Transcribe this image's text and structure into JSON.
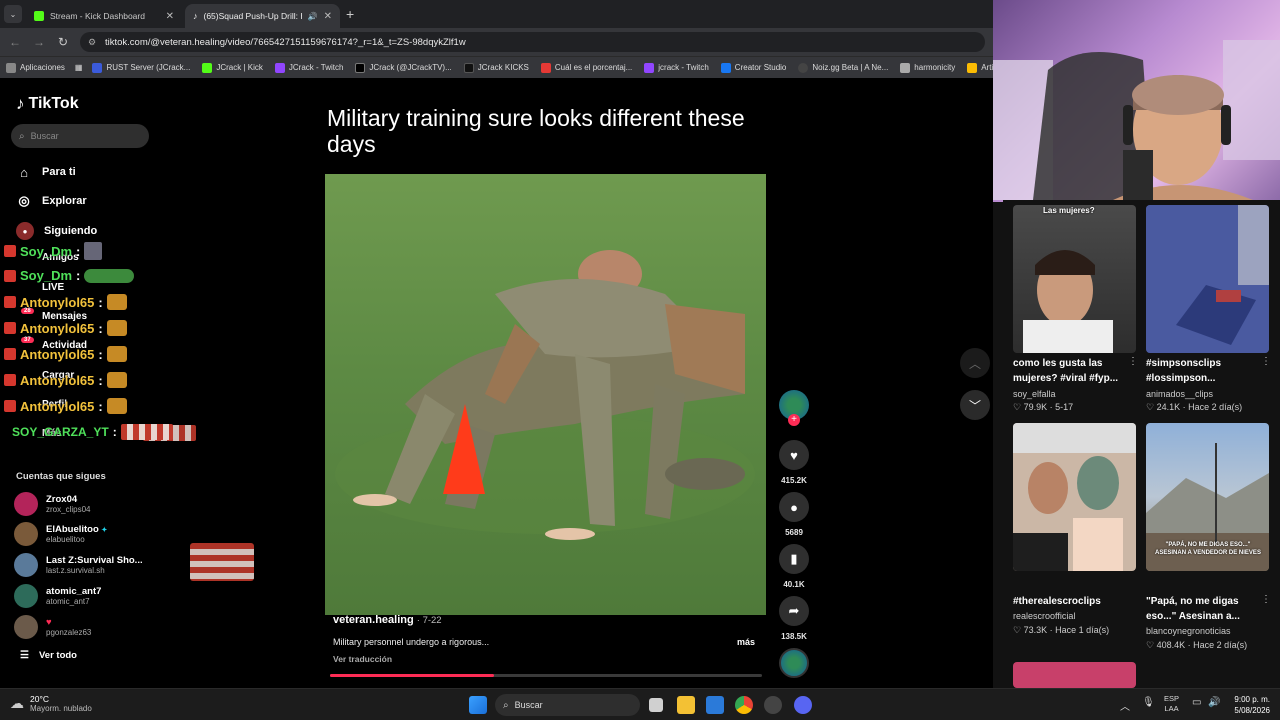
{
  "tabs": [
    {
      "label": "Stream - Kick Dashboard",
      "active": false
    },
    {
      "label": "(65)Squad Push-Up Drill: He",
      "active": true
    }
  ],
  "url": "tiktok.com/@veteran.healing/video/7665427151159676174?_r=1&_t=ZS-98dqykZlf1w",
  "bookmarks": [
    "Aplicaciones",
    "RUST Server (JCrack...",
    "JCrack | Kick",
    "JCrack - Twitch",
    "JCrack (@JCrackTV)...",
    "JCrack KICKS",
    "Cuál es el porcentaj...",
    "jcrack - Twitch",
    "Creator Studio",
    "Noiz.gg Beta | A Ne...",
    "harmonicity",
    "Articu"
  ],
  "tiktok": {
    "logo": "TikTok",
    "search_placeholder": "Buscar",
    "nav": [
      {
        "label": "Para ti",
        "icon": "home-icon"
      },
      {
        "label": "Explorar",
        "icon": "compass-icon"
      },
      {
        "label": "Siguiendo",
        "icon": "following-icon"
      },
      {
        "label": "Amigos",
        "icon": "friends-icon"
      },
      {
        "label": "LIVE",
        "icon": "live-icon"
      },
      {
        "label": "Mensajes",
        "icon": "messages-icon",
        "badge": "28"
      },
      {
        "label": "Actividad",
        "icon": "activity-icon",
        "badge": "37"
      },
      {
        "label": "Cargar",
        "icon": "upload-icon"
      },
      {
        "label": "Perfil",
        "icon": "profile-icon"
      },
      {
        "label": "Más",
        "icon": "more-icon"
      }
    ],
    "following_header": "Cuentas que sigues",
    "following": [
      {
        "name": "Zrox04",
        "handle": "zrox_clips04"
      },
      {
        "name": "ElAbuelitoo",
        "handle": "elabuelitoo"
      },
      {
        "name": "Last Z:Survival Sho...",
        "handle": "last.z.survival.sh"
      },
      {
        "name": "atomic_ant7",
        "handle": "atomic_ant7"
      },
      {
        "name": "",
        "handle": "pgonzalez63"
      }
    ],
    "see_all": "Ver todo",
    "video": {
      "caption_title": "Military training sure looks different these days",
      "author": "veteran.healing",
      "date": "7-22",
      "description": "Military personnel undergo a rigorous...",
      "more": "más",
      "translate": "Ver traducción",
      "progress": 0.38,
      "likes": "415.2K",
      "comments": "5689",
      "saves": "40.1K",
      "shares": "138.5K"
    }
  },
  "chat": [
    {
      "user": "Soy_Dm",
      "color": "#4fe05a"
    },
    {
      "user": "Soy_Dm",
      "color": "#4fe05a"
    },
    {
      "user": "Antonylol65",
      "color": "#f2c23c"
    },
    {
      "user": "Antonylol65",
      "color": "#f2c23c"
    },
    {
      "user": "Antonylol65",
      "color": "#f2c23c"
    },
    {
      "user": "Antonylol65",
      "color": "#f2c23c"
    },
    {
      "user": "Antonylol65",
      "color": "#f2c23c"
    },
    {
      "user": "SOY_GARZA_YT",
      "color": "#4fe05a"
    }
  ],
  "recommended": [
    {
      "title": "como les gusta las mujeres? #viral #fyp...",
      "author": "soy_elfalla",
      "stats": "79.9K · 5-17",
      "overlay": "Las mujeres?"
    },
    {
      "title": "#simpsonsclips #lossimpson...",
      "author": "animados__clips",
      "stats": "24.1K · Hace 2 día(s)",
      "overlay": ""
    },
    {
      "title": "#therealescroclips",
      "author": "realescroofficial",
      "stats": "73.3K · Hace 1 día(s)",
      "overlay": ""
    },
    {
      "title": "\"Papá, no me digas eso...\" Asesinan a...",
      "author": "blancoynegronoticias",
      "stats": "408.4K · Hace 2 día(s)",
      "overlay": "\"PAPÁ, NO ME DIGAS ESO...\" ASESINAN A VENDEDOR DE NIEVES"
    }
  ],
  "taskbar": {
    "weather_temp": "20°C",
    "weather_desc": "Mayorm. nublado",
    "search": "Buscar",
    "lang": "ESP",
    "lang2": "LAA",
    "time": "9:00 p. m.",
    "date": "5/08/2026"
  },
  "colors": {
    "tiktok_red": "#fe2c55",
    "chrome_bg": "#202124"
  }
}
